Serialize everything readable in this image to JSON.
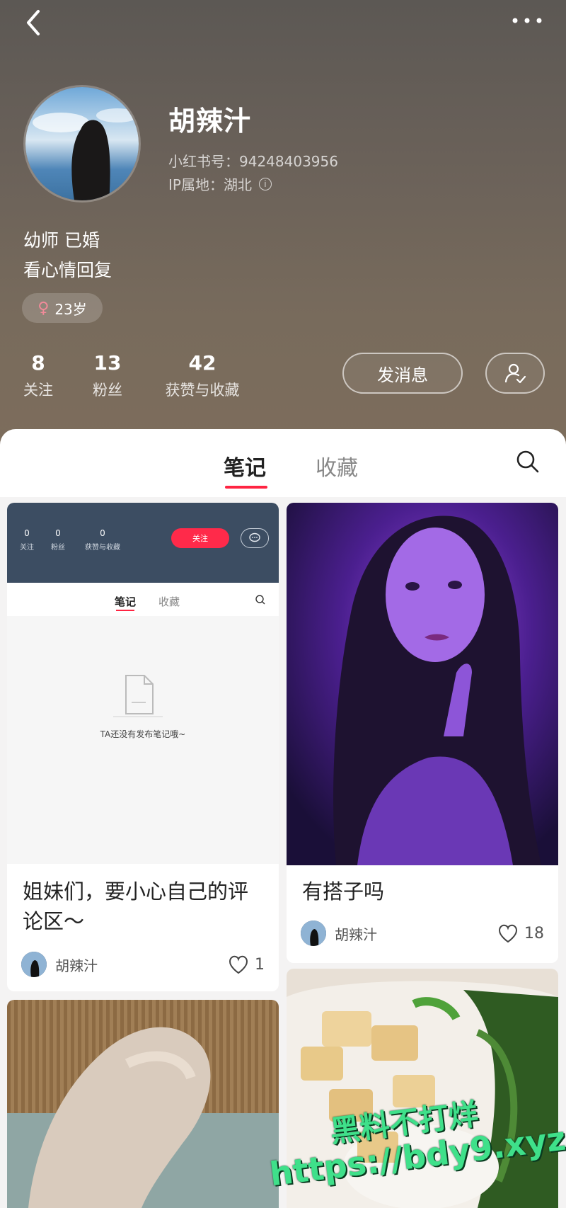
{
  "profile": {
    "name": "胡辣汁",
    "red_id": "小红书号：94248403956",
    "ip": "IP属地：湖北",
    "bio_line1": "幼师 已婚",
    "bio_line2": "看心情回复",
    "age_tag": "23岁",
    "stats": [
      {
        "value": "8",
        "label": "关注"
      },
      {
        "value": "13",
        "label": "粉丝"
      },
      {
        "value": "42",
        "label": "获赞与收藏"
      }
    ],
    "message_button": "发消息"
  },
  "tabs": [
    {
      "label": "笔记",
      "active": true
    },
    {
      "label": "收藏",
      "active": false
    }
  ],
  "notes": [
    {
      "title_line1": "姐妹们，要小心自己的评",
      "title_line2": "论区～",
      "author": "胡辣汁",
      "likes": "1",
      "embedded": {
        "stats": [
          {
            "value": "0",
            "label": "关注"
          },
          {
            "value": "0",
            "label": "粉丝"
          },
          {
            "value": "0",
            "label": "获赞与收藏"
          }
        ],
        "follow_label": "关注",
        "tabs": [
          "笔记",
          "收藏"
        ],
        "empty_text": "TA还没有发布笔记哦~"
      }
    },
    {
      "title": "有搭子吗",
      "author": "胡辣汁",
      "likes": "18"
    }
  ],
  "watermark": {
    "line1": "黑料不打烊",
    "line2": "https://bdy9.xyz"
  },
  "colors": {
    "accent": "#ff2442",
    "header_bg": "#6e6358"
  }
}
